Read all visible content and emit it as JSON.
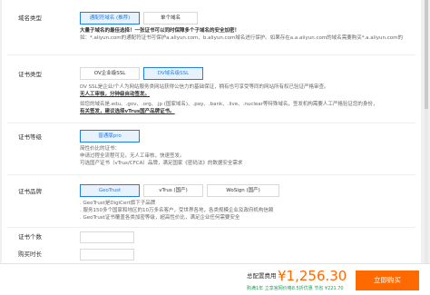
{
  "domain_type": {
    "label": "域名类型",
    "options": [
      {
        "label": "通配符域名 (推荐)",
        "selected": true
      },
      {
        "label": "单个域名",
        "selected": false
      }
    ],
    "desc": [
      "大量子域名的最佳选择！一张证书可以同时保障多个子域名的安全加密！",
      "如：*.aliyun.com的通配符证书可保护a.aliyun.com、b.aliyun.com域名进行保护。如果存在a.a.aliyun.com的域名需要购买*.a.aliyun.com的"
    ]
  },
  "cert_type": {
    "label": "证书类型",
    "options": [
      {
        "label": "OV企业级SSL",
        "selected": false
      },
      {
        "label": "DV域名级SSL",
        "selected": true
      }
    ],
    "desc": [
      "DV SSL是企业/个人为网站服务类网站获得公信力的基础保证，拥有也可享受等同的网站所有权已验证严格审查。",
      "无人工审核，分钟级自动签发。",
      "如您的域名是.edu、.gov、.org、.jp (国家域名)、.pay、.bank、.live、.nuclear等特殊域名，签发机构需要人工严格验证您的身份，",
      "有关签发，建议选择vTrus国产品牌证书。"
    ]
  },
  "cert_level": {
    "label": "证书等级",
    "options": [
      {
        "label": "普通版pro",
        "selected": true
      }
    ],
    "desc": [
      "简性价比的证书：",
      "申请过程全流程可见，无人工审核，快速签发。",
      "可选国产证书（vTrus/CFCA）品牌，满足国家《密码法》的数据安全需求"
    ]
  },
  "cert_brand": {
    "label": "证书品牌",
    "options": [
      {
        "label": "GeoTrust",
        "selected": true
      },
      {
        "label": "vTrus (国产)",
        "selected": false
      },
      {
        "label": "WoSign (国产)",
        "selected": false
      }
    ],
    "desc": [
      ". GeoTrust是DigiCert旗下子品牌",
      ". 服务150多个国家和地区的10万多名客户，受世界各地，各类规模企业及政府机构信赖",
      ". GeoTrust证书覆盖各类加密等级，超高性价比，满足企业任何需要安全"
    ]
  },
  "quantity_rows": [
    "证书个数",
    "购买时长"
  ],
  "footer": {
    "price_label": "总配置费用",
    "price": "¥1,256.30",
    "discount": "购满1年 立享官网价格8.5折优惠 节省 ¥221.70",
    "buy_label": "立即购买"
  },
  "colors": {
    "accent": "#1f7fe8",
    "buy": "#ff6a00",
    "discount": "#1aa35a"
  }
}
